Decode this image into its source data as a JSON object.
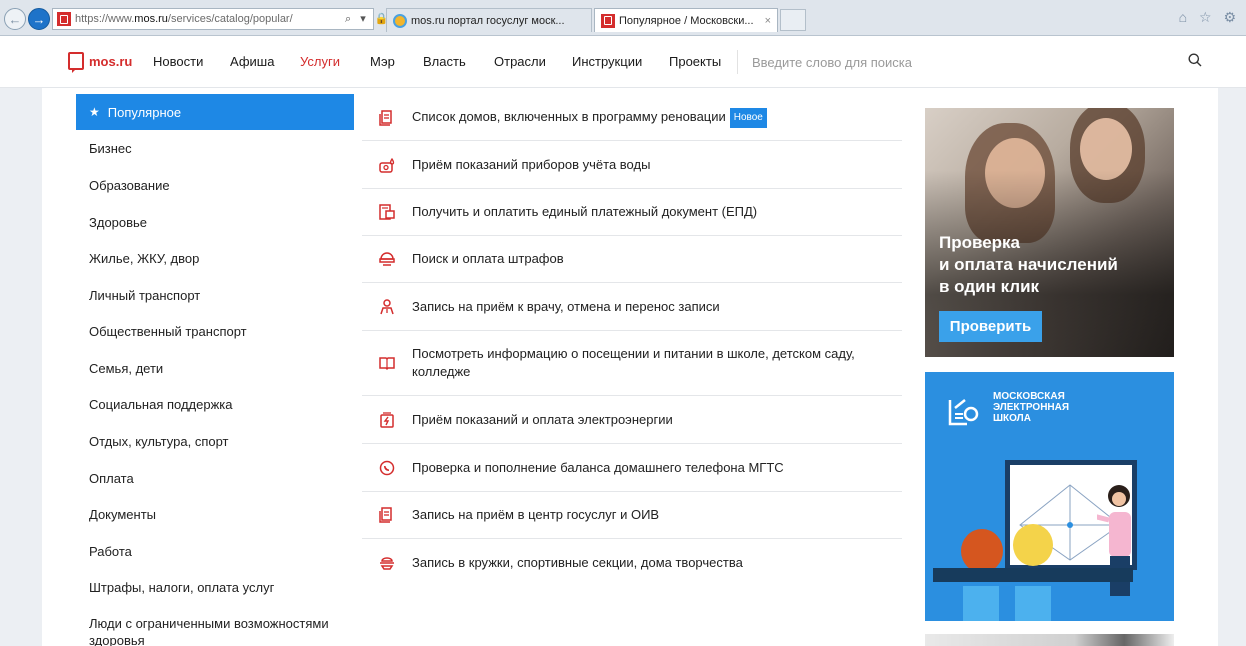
{
  "browser": {
    "url_prefix": "https://www.",
    "url_host": "mos.ru",
    "url_path": "/services/catalog/popular/",
    "address_icons": "⌕ ▾ 🔒 ↻",
    "tabs": [
      {
        "label": "mos.ru портал госуслуг моск..."
      },
      {
        "label": "Популярное / Московски...",
        "close": "×"
      }
    ],
    "right_icons": "⌂ ☆ ⚙"
  },
  "header": {
    "logo_text": "mos.ru",
    "menu": [
      {
        "label": "Новости"
      },
      {
        "label": "Афиша"
      },
      {
        "label": "Услуги"
      },
      {
        "label": "Мэр"
      },
      {
        "label": "Власть"
      },
      {
        "label": "Отрасли"
      },
      {
        "label": "Инструкции"
      },
      {
        "label": "Проекты"
      }
    ],
    "search_placeholder": "Введите слово для поиска"
  },
  "sidebar": {
    "items": [
      {
        "label": "Популярное"
      },
      {
        "label": "Бизнес"
      },
      {
        "label": "Образование"
      },
      {
        "label": "Здоровье"
      },
      {
        "label": "Жилье, ЖКУ, двор"
      },
      {
        "label": "Личный транспорт"
      },
      {
        "label": "Общественный транспорт"
      },
      {
        "label": "Семья, дети"
      },
      {
        "label": "Социальная поддержка"
      },
      {
        "label": "Отдых, культура, спорт"
      },
      {
        "label": "Оплата"
      },
      {
        "label": "Документы"
      },
      {
        "label": "Работа"
      },
      {
        "label": "Штрафы, налоги, оплата услуг"
      },
      {
        "label": "Люди с ограниченными возможностями здоровья"
      }
    ]
  },
  "services": {
    "items": [
      {
        "label": "Список домов, включенных в программу реновации",
        "badge": "Новое",
        "icon": "document-icon"
      },
      {
        "label": "Приём показаний приборов учёта воды",
        "icon": "water-meter-icon"
      },
      {
        "label": "Получить и оплатить единый платежный документ (ЕПД)",
        "icon": "payment-document-icon"
      },
      {
        "label": "Поиск и оплата штрафов",
        "icon": "fines-icon"
      },
      {
        "label": "Запись на приём к врачу, отмена и перенос записи",
        "icon": "doctor-icon"
      },
      {
        "label": "Посмотреть информацию о посещении и питании в школе, детском саду, колледже",
        "icon": "school-book-icon"
      },
      {
        "label": "Приём показаний и оплата электроэнергии",
        "icon": "electricity-icon"
      },
      {
        "label": "Проверка и пополнение баланса домашнего телефона МГТС",
        "icon": "phone-icon"
      },
      {
        "label": "Запись на приём в центр госуслуг и ОИВ",
        "icon": "document-icon"
      },
      {
        "label": "Запись в кружки, спортивные секции, дома творчества",
        "icon": "clubs-icon"
      }
    ]
  },
  "banners": {
    "banner1": {
      "title_lines": [
        "Проверка",
        "и оплата начислений",
        "в один клик"
      ],
      "button": "Проверить"
    },
    "banner2": {
      "title_lines": [
        "МОСКОВСКАЯ",
        "ЭЛЕКТРОННАЯ",
        "ШКОЛА"
      ]
    }
  },
  "colors": {
    "brand_red": "#d42d2d",
    "accent_blue": "#1e88e5",
    "banner_blue": "#2b8fe0"
  }
}
